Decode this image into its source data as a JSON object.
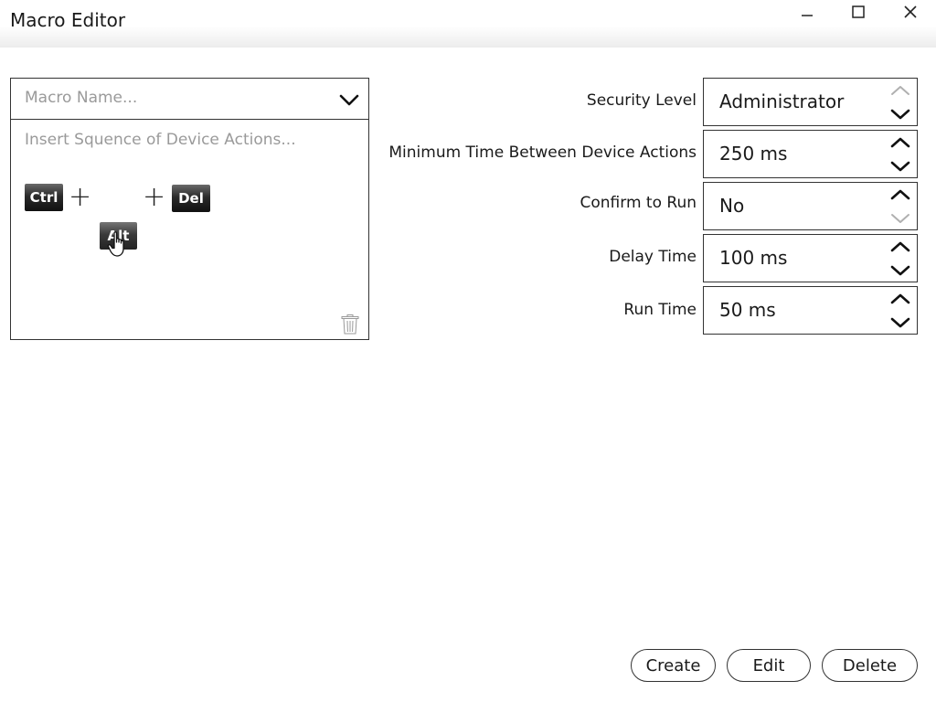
{
  "window": {
    "title": "Macro Editor",
    "controls": [
      "minimize",
      "maximize",
      "close"
    ]
  },
  "macro": {
    "name_placeholder": "Macro Name...",
    "sequence_placeholder": "Insert Squence of Device Actions...",
    "keys": [
      {
        "label": "Ctrl"
      },
      {
        "label": "Del"
      },
      {
        "label": "Alt",
        "state": "dragging"
      }
    ],
    "separator": "+"
  },
  "settings": [
    {
      "label": "Security Level",
      "value": "Administrator",
      "up_enabled": false,
      "down_enabled": true
    },
    {
      "label": "Minimum Time Between Device Actions",
      "value": "250 ms",
      "up_enabled": true,
      "down_enabled": true
    },
    {
      "label": "Confirm to Run",
      "value": "No",
      "up_enabled": true,
      "down_enabled": false
    },
    {
      "label": "Delay Time",
      "value": "100 ms",
      "up_enabled": true,
      "down_enabled": true
    },
    {
      "label": "Run Time",
      "value": "50 ms",
      "up_enabled": true,
      "down_enabled": true
    }
  ],
  "actions": {
    "create_label": "Create",
    "edit_label": "Edit",
    "delete_label": "Delete"
  },
  "colors": {
    "enabled_arrow": "#111111",
    "disabled_arrow": "#b0b0b0",
    "key_background": "#222222"
  }
}
